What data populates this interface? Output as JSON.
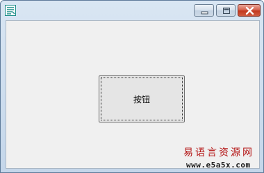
{
  "window": {
    "title": "",
    "icons": {
      "app": "app-icon",
      "minimize": "minimize-icon",
      "maximize": "maximize-icon",
      "close": "close-icon"
    }
  },
  "main": {
    "button_label": "按钮"
  },
  "watermark": {
    "site_name": "易语言资源网",
    "url": "www.e5a5x.com"
  },
  "colors": {
    "close_button": "#c2381f",
    "client_background": "#f0f0f0",
    "watermark_text": "#b41414"
  }
}
